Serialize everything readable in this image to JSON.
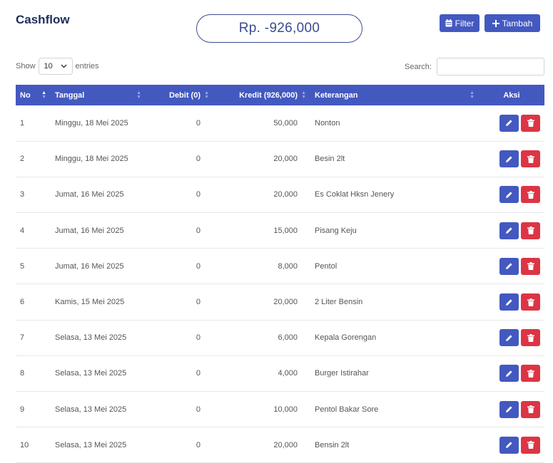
{
  "header": {
    "title": "Cashflow",
    "total": "Rp. -926,000",
    "filter_label": "Filter",
    "tambah_label": "Tambah"
  },
  "controls": {
    "show_label": "Show",
    "entries_value": "10",
    "entries_label": "entries",
    "search_label": "Search:",
    "search_value": ""
  },
  "table": {
    "columns": [
      "No",
      "Tanggal",
      "Debit (0)",
      "Kredit (926,000)",
      "Keterangan",
      "Aksi"
    ],
    "rows": [
      {
        "no": "1",
        "tanggal": "Minggu, 18 Mei 2025",
        "debit": "0",
        "kredit": "50,000",
        "keterangan": "Nonton"
      },
      {
        "no": "2",
        "tanggal": "Minggu, 18 Mei 2025",
        "debit": "0",
        "kredit": "20,000",
        "keterangan": "Besin 2lt"
      },
      {
        "no": "3",
        "tanggal": "Jumat, 16 Mei 2025",
        "debit": "0",
        "kredit": "20,000",
        "keterangan": "Es Coklat Hksn Jenery"
      },
      {
        "no": "4",
        "tanggal": "Jumat, 16 Mei 2025",
        "debit": "0",
        "kredit": "15,000",
        "keterangan": "Pisang Keju"
      },
      {
        "no": "5",
        "tanggal": "Jumat, 16 Mei 2025",
        "debit": "0",
        "kredit": "8,000",
        "keterangan": "Pentol"
      },
      {
        "no": "6",
        "tanggal": "Kamis, 15 Mei 2025",
        "debit": "0",
        "kredit": "20,000",
        "keterangan": "2 Liter Bensin"
      },
      {
        "no": "7",
        "tanggal": "Selasa, 13 Mei 2025",
        "debit": "0",
        "kredit": "6,000",
        "keterangan": "Kepala Gorengan"
      },
      {
        "no": "8",
        "tanggal": "Selasa, 13 Mei 2025",
        "debit": "0",
        "kredit": "4,000",
        "keterangan": "Burger Istirahar"
      },
      {
        "no": "9",
        "tanggal": "Selasa, 13 Mei 2025",
        "debit": "0",
        "kredit": "10,000",
        "keterangan": "Pentol Bakar Sore"
      },
      {
        "no": "10",
        "tanggal": "Selasa, 13 Mei 2025",
        "debit": "0",
        "kredit": "20,000",
        "keterangan": "Bensin 2lt"
      }
    ]
  },
  "icons": {
    "filter": "calendar-icon",
    "tambah": "plus-icon",
    "edit": "pencil-icon",
    "delete": "trash-icon",
    "select": "chevron-down-icon",
    "sort": "sort-icon"
  },
  "colors": {
    "primary": "#4359c0",
    "danger": "#dc3545",
    "title": "#1f2d5a"
  }
}
